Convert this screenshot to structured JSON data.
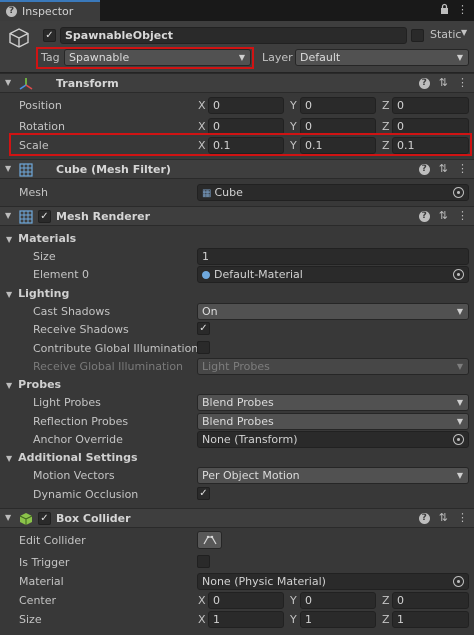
{
  "window": {
    "tab_title": "Inspector",
    "tab_tools": [
      "lock-icon",
      "more-icon"
    ]
  },
  "gameobject": {
    "name": "SpawnableObject",
    "active": true,
    "static_label": "Static",
    "tag_label": "Tag",
    "tag_value": "Spawnable",
    "layer_label": "Layer",
    "layer_value": "Default"
  },
  "transform": {
    "title": "Transform",
    "position": {
      "label": "Position",
      "x": "0",
      "y": "0",
      "z": "0"
    },
    "rotation": {
      "label": "Rotation",
      "x": "0",
      "y": "0",
      "z": "0"
    },
    "scale": {
      "label": "Scale",
      "x": "0.1",
      "y": "0.1",
      "z": "0.1"
    },
    "axes": {
      "x": "X",
      "y": "Y",
      "z": "Z"
    }
  },
  "mesh_filter": {
    "title": "Cube (Mesh Filter)",
    "mesh_label": "Mesh",
    "mesh_value": "Cube"
  },
  "mesh_renderer": {
    "title": "Mesh Renderer",
    "materials": {
      "label": "Materials",
      "size_label": "Size",
      "size_value": "1",
      "element_label": "Element 0",
      "element_value": "Default-Material"
    },
    "lighting": {
      "label": "Lighting",
      "cast_shadows_label": "Cast Shadows",
      "cast_shadows_value": "On",
      "receive_shadows_label": "Receive Shadows",
      "contribute_gi_label": "Contribute Global Illumination",
      "receive_gi_label": "Receive Global Illumination",
      "receive_gi_value": "Light Probes"
    },
    "probes": {
      "label": "Probes",
      "light_probes_label": "Light Probes",
      "light_probes_value": "Blend Probes",
      "reflection_probes_label": "Reflection Probes",
      "reflection_probes_value": "Blend Probes",
      "anchor_label": "Anchor Override",
      "anchor_value": "None (Transform)"
    },
    "additional": {
      "label": "Additional Settings",
      "motion_vectors_label": "Motion Vectors",
      "motion_vectors_value": "Per Object Motion",
      "dynamic_occlusion_label": "Dynamic Occlusion"
    }
  },
  "box_collider": {
    "title": "Box Collider",
    "edit_label": "Edit Collider",
    "trigger_label": "Is Trigger",
    "material_label": "Material",
    "material_value": "None (Physic Material)",
    "center": {
      "label": "Center",
      "x": "0",
      "y": "0",
      "z": "0"
    },
    "size": {
      "label": "Size",
      "x": "1",
      "y": "1",
      "z": "1"
    }
  },
  "glyphs": {
    "check": "✓",
    "fold_open": "▼",
    "dropdown_arrow": "▼",
    "help": "?",
    "more": "⋮",
    "preset": "⇅"
  },
  "colors": {
    "highlight": "#d01313",
    "tab_accent": "#3a79bb",
    "background": "#383838"
  }
}
